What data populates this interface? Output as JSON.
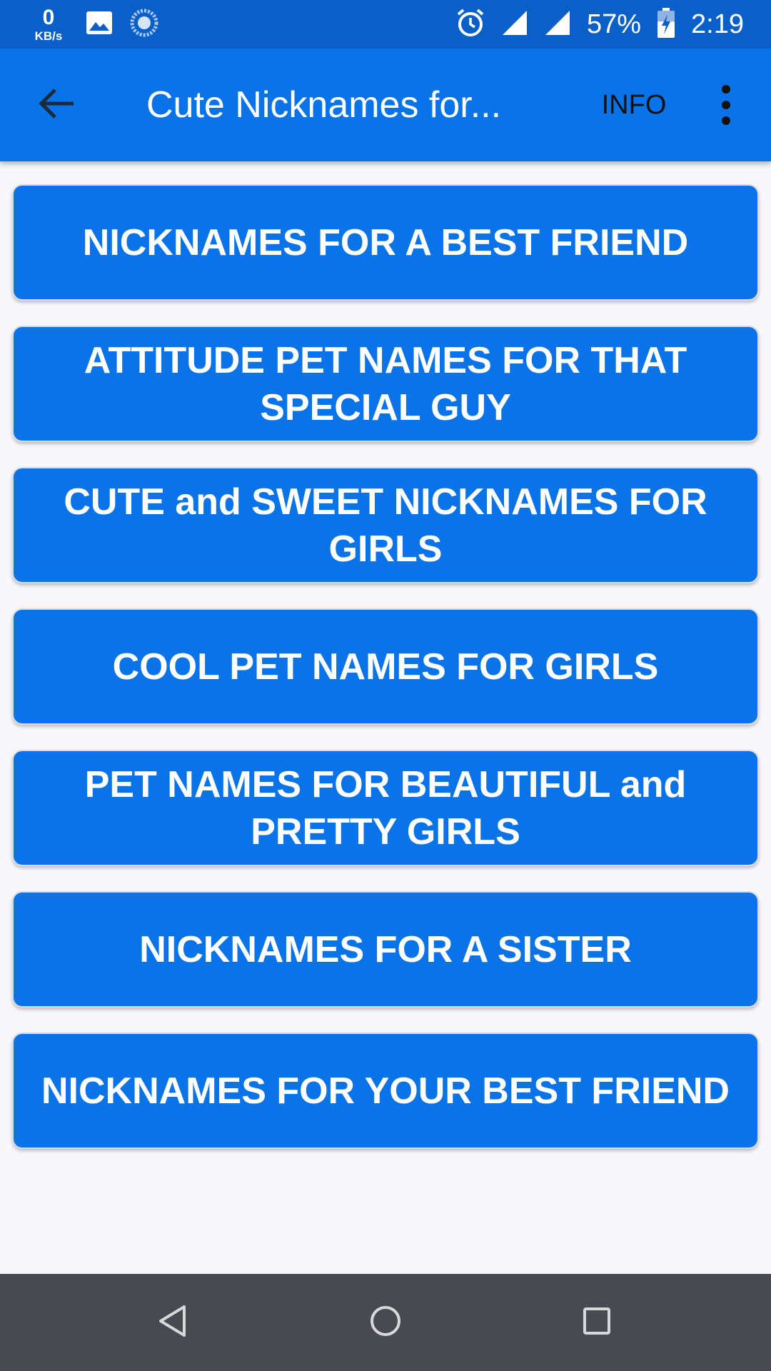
{
  "status_bar": {
    "net_speed_value": "0",
    "net_speed_unit": "KB/s",
    "battery_percent": "57%",
    "time": "2:19",
    "icons": [
      "image-icon",
      "loading-icon",
      "alarm-icon",
      "signal-icon",
      "signal-icon",
      "battery-charging-icon"
    ]
  },
  "app_bar": {
    "title": "Cute Nicknames for...",
    "info_label": "INFO",
    "back_icon": "back-arrow-icon",
    "overflow_icon": "overflow-menu-icon"
  },
  "menu": {
    "items": [
      {
        "label": "NICKNAMES FOR A BEST FRIEND"
      },
      {
        "label": "ATTITUDE PET NAMES FOR THAT SPECIAL GUY"
      },
      {
        "label": "CUTE and SWEET NICKNAMES FOR GIRLS"
      },
      {
        "label": "COOL PET NAMES FOR GIRLS"
      },
      {
        "label": "PET NAMES FOR BEAUTIFUL and PRETTY GIRLS"
      },
      {
        "label": "NICKNAMES FOR A SISTER"
      },
      {
        "label": "NICKNAMES FOR YOUR BEST FRIEND"
      }
    ]
  },
  "nav_bar": {
    "icons": [
      "nav-back-icon",
      "nav-home-icon",
      "nav-recents-icon"
    ]
  },
  "colors": {
    "status_bar": "#0a5fc8",
    "app_bar": "#0a73e8",
    "button": "#0a73e8",
    "nav_bar": "#474a50",
    "background": "#f7f7f9"
  }
}
